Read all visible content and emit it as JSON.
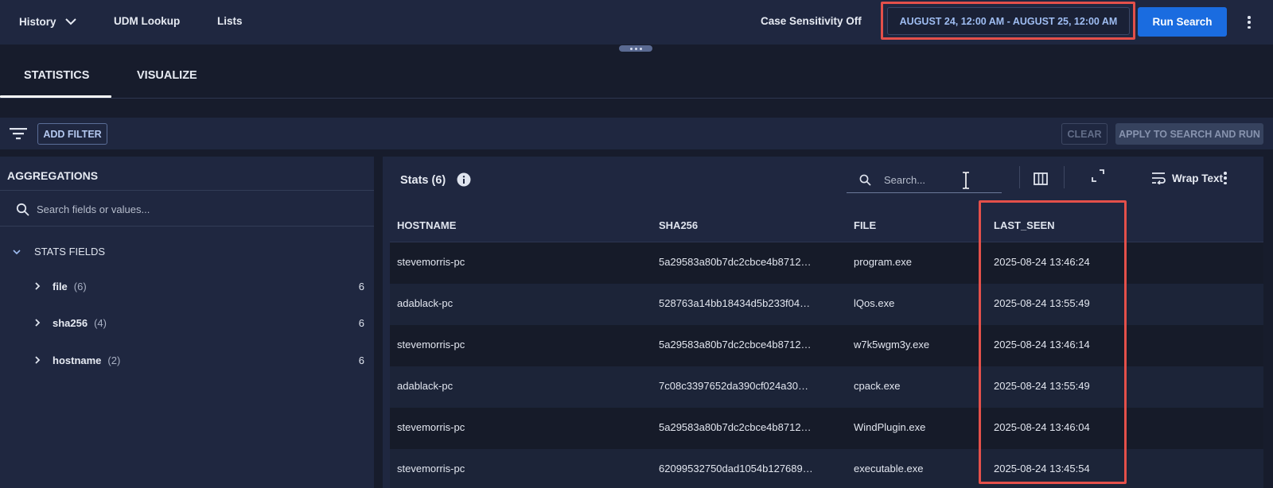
{
  "topbar": {
    "history_label": "History",
    "udm_lookup_label": "UDM Lookup",
    "lists_label": "Lists",
    "case_sensitivity_label": "Case Sensitivity Off",
    "date_range_label": "AUGUST 24, 12:00 AM - AUGUST 25, 12:00 AM",
    "run_search_label": "Run Search",
    "highlight_color": "#e4504a",
    "accent_color": "#1a6ce0"
  },
  "tabs": [
    {
      "label": "STATISTICS",
      "active": true
    },
    {
      "label": "VISUALIZE",
      "active": false
    }
  ],
  "filterbar": {
    "add_filter_label": "ADD FILTER",
    "clear_label": "CLEAR",
    "apply_label": "APPLY TO SEARCH AND RUN"
  },
  "aggregations": {
    "title": "AGGREGATIONS",
    "search_placeholder": "Search fields or values...",
    "section_label": "STATS FIELDS",
    "fields": [
      {
        "name": "file",
        "count": "(6)",
        "total": "6"
      },
      {
        "name": "sha256",
        "count": "(4)",
        "total": "6"
      },
      {
        "name": "hostname",
        "count": "(2)",
        "total": "6"
      }
    ]
  },
  "stats": {
    "title": "Stats (6)",
    "search_placeholder": "Search...",
    "wrap_text_label": "Wrap Text",
    "columns": [
      "HOSTNAME",
      "SHA256",
      "FILE",
      "LAST_SEEN"
    ],
    "rows": [
      {
        "hostname": "stevemorris-pc",
        "sha256": "5a29583a80b7dc2cbce4b8712…",
        "file": "program.exe",
        "last_seen": "2025-08-24 13:46:24"
      },
      {
        "hostname": "adablack-pc",
        "sha256": "528763a14bb18434d5b233f04…",
        "file": "lQos.exe",
        "last_seen": "2025-08-24 13:55:49"
      },
      {
        "hostname": "stevemorris-pc",
        "sha256": "5a29583a80b7dc2cbce4b8712…",
        "file": "w7k5wgm3y.exe",
        "last_seen": "2025-08-24 13:46:14"
      },
      {
        "hostname": "adablack-pc",
        "sha256": "7c08c3397652da390cf024a30…",
        "file": "cpack.exe",
        "last_seen": "2025-08-24 13:55:49"
      },
      {
        "hostname": "stevemorris-pc",
        "sha256": "5a29583a80b7dc2cbce4b8712…",
        "file": "WindPlugin.exe",
        "last_seen": "2025-08-24 13:46:04"
      },
      {
        "hostname": "stevemorris-pc",
        "sha256": "62099532750dad1054b127689…",
        "file": "executable.exe",
        "last_seen": "2025-08-24 13:45:54"
      }
    ]
  }
}
